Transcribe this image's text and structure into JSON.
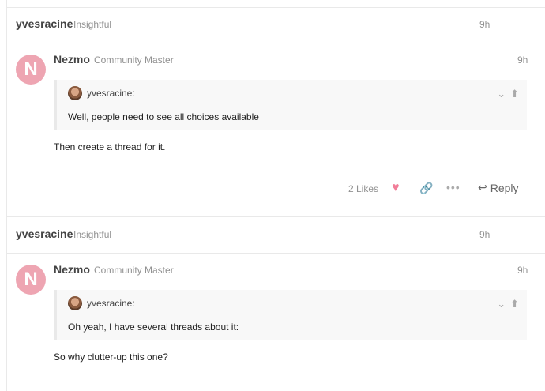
{
  "posts": [
    {
      "kind": "summary",
      "username": "yvesracine",
      "user_title": "Insightful",
      "time": "9h"
    },
    {
      "kind": "full",
      "avatar_letter": "N",
      "username": "Nezmo",
      "user_title": "Community Master",
      "time": "9h",
      "quote": {
        "username": "yvesracine:",
        "text": "Well, people need to see all choices available"
      },
      "body": "Then create a thread for it.",
      "likes_label": "2 Likes",
      "reply_label": "Reply"
    },
    {
      "kind": "summary",
      "username": "yvesracine",
      "user_title": "Insightful",
      "time": "9h"
    },
    {
      "kind": "full",
      "avatar_letter": "N",
      "username": "Nezmo",
      "user_title": "Community Master",
      "time": "9h",
      "quote": {
        "username": "yvesracine:",
        "text": "Oh yeah, I have several threads about it:"
      },
      "body": "So why clutter-up this one?"
    }
  ],
  "icons": {
    "heart": "heart-icon",
    "link": "link-icon",
    "more": "ellipsis-icon",
    "reply": "reply-icon",
    "expand": "chevron-down-icon",
    "up": "arrow-up-icon"
  },
  "colors": {
    "avatar_bg": "#eea5b2",
    "heart": "#f17d98",
    "muted": "#919191"
  }
}
